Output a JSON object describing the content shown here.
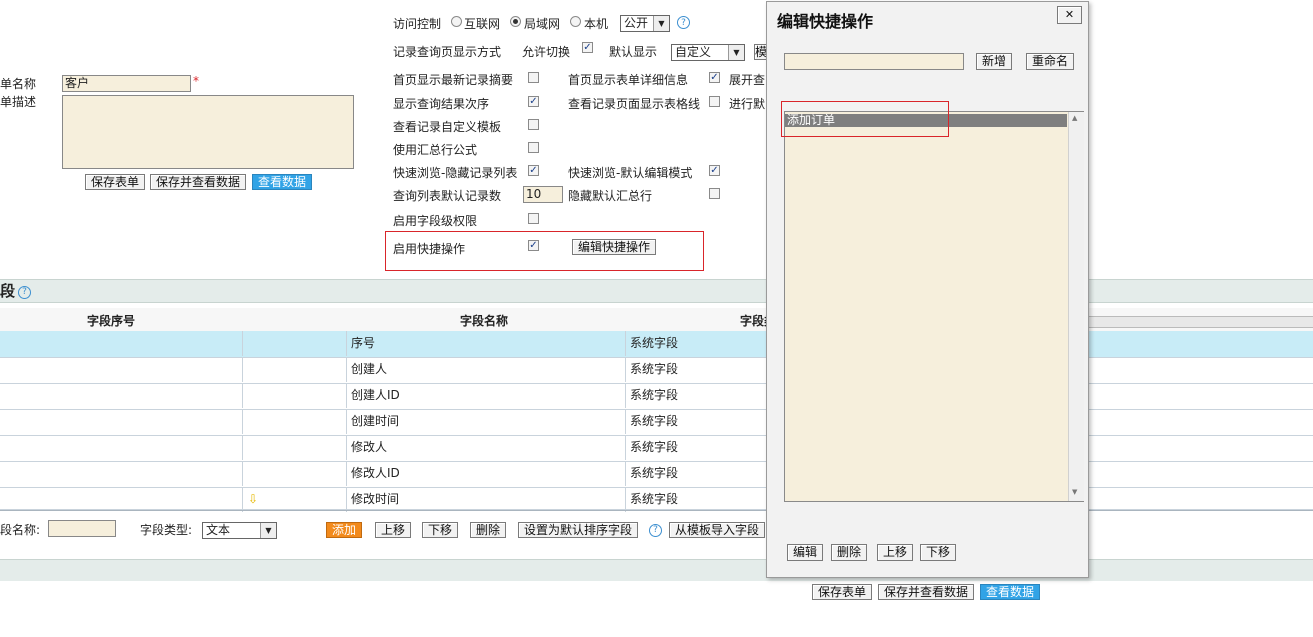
{
  "left_form": {
    "name_label": "单名称",
    "name_value": "客户",
    "required_mark": "*",
    "desc_label": "单描述",
    "save_label": "保存表单",
    "save_view_label": "保存并查看数据",
    "view_label": "查看数据"
  },
  "settings": {
    "access_label": "访问控制",
    "access_options": [
      "互联网",
      "局域网",
      "本机"
    ],
    "access_selected": "局域网",
    "visibility_value": "公开",
    "display_mode_label": "记录查询页显示方式",
    "allow_switch_label": "允许切换",
    "default_display_label": "默认显示",
    "default_display_value": "自定义",
    "rows": [
      {
        "label": "首页显示最新记录摘要",
        "checked": false
      },
      {
        "label": "显示查询结果次序",
        "checked": true
      },
      {
        "label": "查看记录自定义模板",
        "checked": false
      },
      {
        "label": "使用汇总行公式",
        "checked": false
      },
      {
        "label": "快速浏览-隐藏记录列表",
        "checked": true
      },
      {
        "label": "查询列表默认记录数",
        "value": "10"
      },
      {
        "label": "启用字段级权限",
        "checked": false
      },
      {
        "label": "启用快捷操作",
        "checked": true
      }
    ],
    "right_rows": [
      {
        "label": "首页显示表单详细信息",
        "checked": true,
        "extra": "展开查"
      },
      {
        "label": "查看记录页面显示表格线",
        "checked": false,
        "extra": "进行默"
      },
      {
        "label": "快速浏览-默认编辑模式",
        "checked": true
      },
      {
        "label": "隐藏默认汇总行",
        "checked": false
      }
    ],
    "edit_shortcut_label": "编辑快捷操作"
  },
  "fields_section": {
    "title": "段",
    "headers": [
      "字段序号",
      "字段名称",
      "字段类"
    ],
    "rows": [
      {
        "name": "序号",
        "type": "系统字段",
        "highlighted": true
      },
      {
        "name": "创建人",
        "type": "系统字段"
      },
      {
        "name": "创建人ID",
        "type": "系统字段"
      },
      {
        "name": "创建时间",
        "type": "系统字段"
      },
      {
        "name": "修改人",
        "type": "系统字段"
      },
      {
        "name": "修改人ID",
        "type": "系统字段"
      },
      {
        "name": "修改时间",
        "type": "系统字段"
      }
    ],
    "field_name_label": "段名称:",
    "field_type_label": "字段类型:",
    "field_type_value": "文本",
    "add_label": "添加",
    "up_label": "上移",
    "down_label": "下移",
    "delete_label": "删除",
    "default_sort_label": "设置为默认排序字段",
    "import_label": "从模板导入字段"
  },
  "bottom": {
    "save_label": "保存表单",
    "save_view_label": "保存并查看数据",
    "view_label": "查看数据"
  },
  "dialog": {
    "title": "编辑快捷操作",
    "close": "✕",
    "new_label": "新增",
    "rename_label": "重命名",
    "list_items": [
      "添加订单"
    ],
    "edit_label": "编辑",
    "delete_label": "删除",
    "up_label": "上移",
    "down_label": "下移"
  },
  "colors": {
    "accent_blue": "#31a3e6",
    "orange": "#f28a1c",
    "highlight_red": "#d9252a",
    "cream": "#f6efdc",
    "row_highlight": "#c8ecf7"
  }
}
